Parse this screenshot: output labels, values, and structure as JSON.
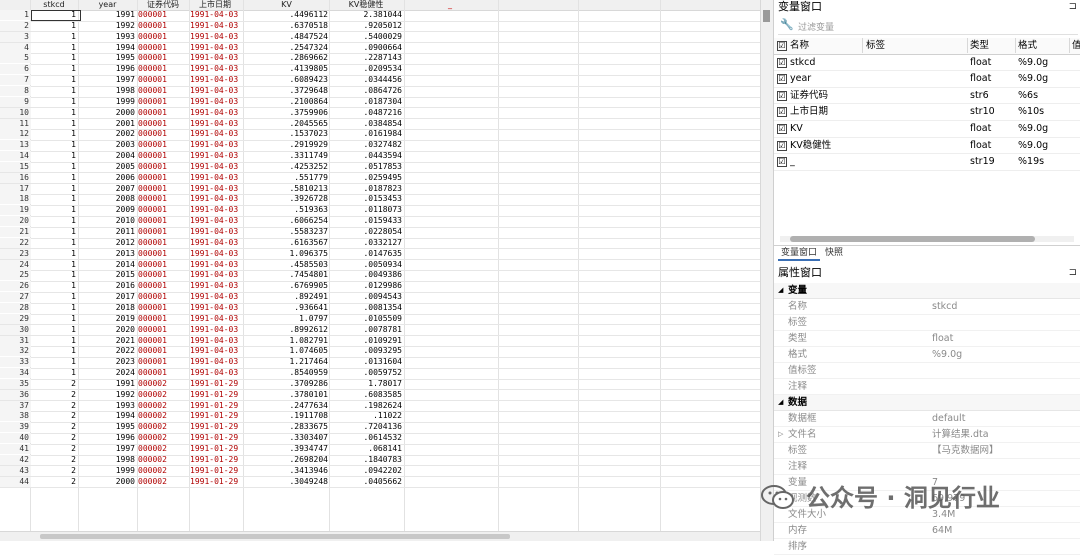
{
  "editor": {
    "columns": [
      "stkcd",
      "year",
      "证券代码",
      "上市日期",
      "KV",
      "KV稳健性"
    ],
    "extra_header": "_",
    "rows": [
      [
        "1",
        "1",
        "1991",
        "000001",
        "1991-04-03",
        ".4496112",
        "2.381044"
      ],
      [
        "2",
        "1",
        "1992",
        "000001",
        "1991-04-03",
        ".6370518",
        ".9205012"
      ],
      [
        "3",
        "1",
        "1993",
        "000001",
        "1991-04-03",
        ".4847524",
        ".5400029"
      ],
      [
        "4",
        "1",
        "1994",
        "000001",
        "1991-04-03",
        ".2547324",
        ".0900664"
      ],
      [
        "5",
        "1",
        "1995",
        "000001",
        "1991-04-03",
        ".2869662",
        ".2287143"
      ],
      [
        "6",
        "1",
        "1996",
        "000001",
        "1991-04-03",
        ".4139805",
        ".0209534"
      ],
      [
        "7",
        "1",
        "1997",
        "000001",
        "1991-04-03",
        ".6089423",
        ".0344456"
      ],
      [
        "8",
        "1",
        "1998",
        "000001",
        "1991-04-03",
        ".3729648",
        ".0864726"
      ],
      [
        "9",
        "1",
        "1999",
        "000001",
        "1991-04-03",
        ".2100864",
        ".0187304"
      ],
      [
        "10",
        "1",
        "2000",
        "000001",
        "1991-04-03",
        ".3759906",
        ".0487216"
      ],
      [
        "11",
        "1",
        "2001",
        "000001",
        "1991-04-03",
        ".2045565",
        ".0384854"
      ],
      [
        "12",
        "1",
        "2002",
        "000001",
        "1991-04-03",
        ".1537023",
        ".0161984"
      ],
      [
        "13",
        "1",
        "2003",
        "000001",
        "1991-04-03",
        ".2919929",
        ".0327482"
      ],
      [
        "14",
        "1",
        "2004",
        "000001",
        "1991-04-03",
        ".3311749",
        ".0443594"
      ],
      [
        "15",
        "1",
        "2005",
        "000001",
        "1991-04-03",
        ".4253252",
        ".0517853"
      ],
      [
        "16",
        "1",
        "2006",
        "000001",
        "1991-04-03",
        ".551779",
        ".0259495"
      ],
      [
        "17",
        "1",
        "2007",
        "000001",
        "1991-04-03",
        ".5810213",
        ".0187823"
      ],
      [
        "18",
        "1",
        "2008",
        "000001",
        "1991-04-03",
        ".3926728",
        ".0153453"
      ],
      [
        "19",
        "1",
        "2009",
        "000001",
        "1991-04-03",
        ".519363",
        ".0118073"
      ],
      [
        "20",
        "1",
        "2010",
        "000001",
        "1991-04-03",
        ".6066254",
        ".0159433"
      ],
      [
        "21",
        "1",
        "2011",
        "000001",
        "1991-04-03",
        ".5583237",
        ".0228054"
      ],
      [
        "22",
        "1",
        "2012",
        "000001",
        "1991-04-03",
        ".6163567",
        ".0332127"
      ],
      [
        "23",
        "1",
        "2013",
        "000001",
        "1991-04-03",
        "1.096375",
        ".0147635"
      ],
      [
        "24",
        "1",
        "2014",
        "000001",
        "1991-04-03",
        ".4585503",
        ".0050934"
      ],
      [
        "25",
        "1",
        "2015",
        "000001",
        "1991-04-03",
        ".7454801",
        ".0049386"
      ],
      [
        "26",
        "1",
        "2016",
        "000001",
        "1991-04-03",
        ".6769905",
        ".0129986"
      ],
      [
        "27",
        "1",
        "2017",
        "000001",
        "1991-04-03",
        ".892491",
        ".0094543"
      ],
      [
        "28",
        "1",
        "2018",
        "000001",
        "1991-04-03",
        ".936641",
        ".0081354"
      ],
      [
        "29",
        "1",
        "2019",
        "000001",
        "1991-04-03",
        "1.0797",
        ".0105509"
      ],
      [
        "30",
        "1",
        "2020",
        "000001",
        "1991-04-03",
        ".8992612",
        ".0078781"
      ],
      [
        "31",
        "1",
        "2021",
        "000001",
        "1991-04-03",
        "1.082791",
        ".0109291"
      ],
      [
        "32",
        "1",
        "2022",
        "000001",
        "1991-04-03",
        "1.074605",
        ".0093295"
      ],
      [
        "33",
        "1",
        "2023",
        "000001",
        "1991-04-03",
        "1.217464",
        ".0131604"
      ],
      [
        "34",
        "1",
        "2024",
        "000001",
        "1991-04-03",
        ".8540959",
        ".0059752"
      ],
      [
        "35",
        "2",
        "1991",
        "000002",
        "1991-01-29",
        ".3709286",
        "1.78017"
      ],
      [
        "36",
        "2",
        "1992",
        "000002",
        "1991-01-29",
        ".3780101",
        ".6083585"
      ],
      [
        "37",
        "2",
        "1993",
        "000002",
        "1991-01-29",
        ".2477634",
        ".1982624"
      ],
      [
        "38",
        "2",
        "1994",
        "000002",
        "1991-01-29",
        ".1911708",
        ".11022"
      ],
      [
        "39",
        "2",
        "1995",
        "000002",
        "1991-01-29",
        ".2833675",
        ".7204136"
      ],
      [
        "40",
        "2",
        "1996",
        "000002",
        "1991-01-29",
        ".3303407",
        ".0614532"
      ],
      [
        "41",
        "2",
        "1997",
        "000002",
        "1991-01-29",
        ".3934747",
        ".068141"
      ],
      [
        "42",
        "2",
        "1998",
        "000002",
        "1991-01-29",
        ".2698204",
        ".1840783"
      ],
      [
        "43",
        "2",
        "1999",
        "000002",
        "1991-01-29",
        ".3413946",
        ".0942202"
      ],
      [
        "44",
        "2",
        "2000",
        "000002",
        "1991-01-29",
        ".3049248",
        ".0405662"
      ]
    ]
  },
  "variables_window": {
    "title": "变量窗口",
    "pin": "⊐",
    "filter_placeholder": "过滤变量",
    "headers": {
      "name": "名称",
      "label": "标签",
      "type": "类型",
      "format": "格式",
      "value": "值"
    },
    "vars": [
      {
        "name": "stkcd",
        "label": "",
        "type": "float",
        "format": "%9.0g"
      },
      {
        "name": "year",
        "label": "",
        "type": "float",
        "format": "%9.0g"
      },
      {
        "name": "证券代码",
        "label": "",
        "type": "str6",
        "format": "%6s"
      },
      {
        "name": "上市日期",
        "label": "",
        "type": "str10",
        "format": "%10s"
      },
      {
        "name": "KV",
        "label": "",
        "type": "float",
        "format": "%9.0g"
      },
      {
        "name": "KV稳健性",
        "label": "",
        "type": "float",
        "format": "%9.0g"
      },
      {
        "name": "_",
        "label": "",
        "type": "str19",
        "format": "%19s"
      }
    ],
    "check": "☑"
  },
  "tabs": {
    "vars": "变量窗口",
    "snapshot": "快照"
  },
  "properties_window": {
    "title": "属性窗口",
    "pin": "⊐",
    "sections": [
      {
        "title": "变量",
        "rows": [
          {
            "k": "名称",
            "v": "stkcd"
          },
          {
            "k": "标签",
            "v": ""
          },
          {
            "k": "类型",
            "v": "float"
          },
          {
            "k": "格式",
            "v": "%9.0g"
          },
          {
            "k": "值标签",
            "v": ""
          },
          {
            "k": "注释",
            "v": ""
          }
        ]
      },
      {
        "title": "数据",
        "rows": [
          {
            "k": "数据框",
            "v": "default"
          },
          {
            "k": "文件名",
            "v": "计算结果.dta"
          },
          {
            "k": "标签",
            "v": "【马克数据网】"
          },
          {
            "k": "注释",
            "v": ""
          },
          {
            "k": "变量",
            "v": "7"
          },
          {
            "k": "观测数",
            "v": "69,979"
          },
          {
            "k": "文件大小",
            "v": "3.4M"
          },
          {
            "k": "内存",
            "v": "64M"
          },
          {
            "k": "排序",
            "v": ""
          }
        ]
      }
    ]
  },
  "watermark": {
    "text": "公众号 · 洞见行业"
  }
}
